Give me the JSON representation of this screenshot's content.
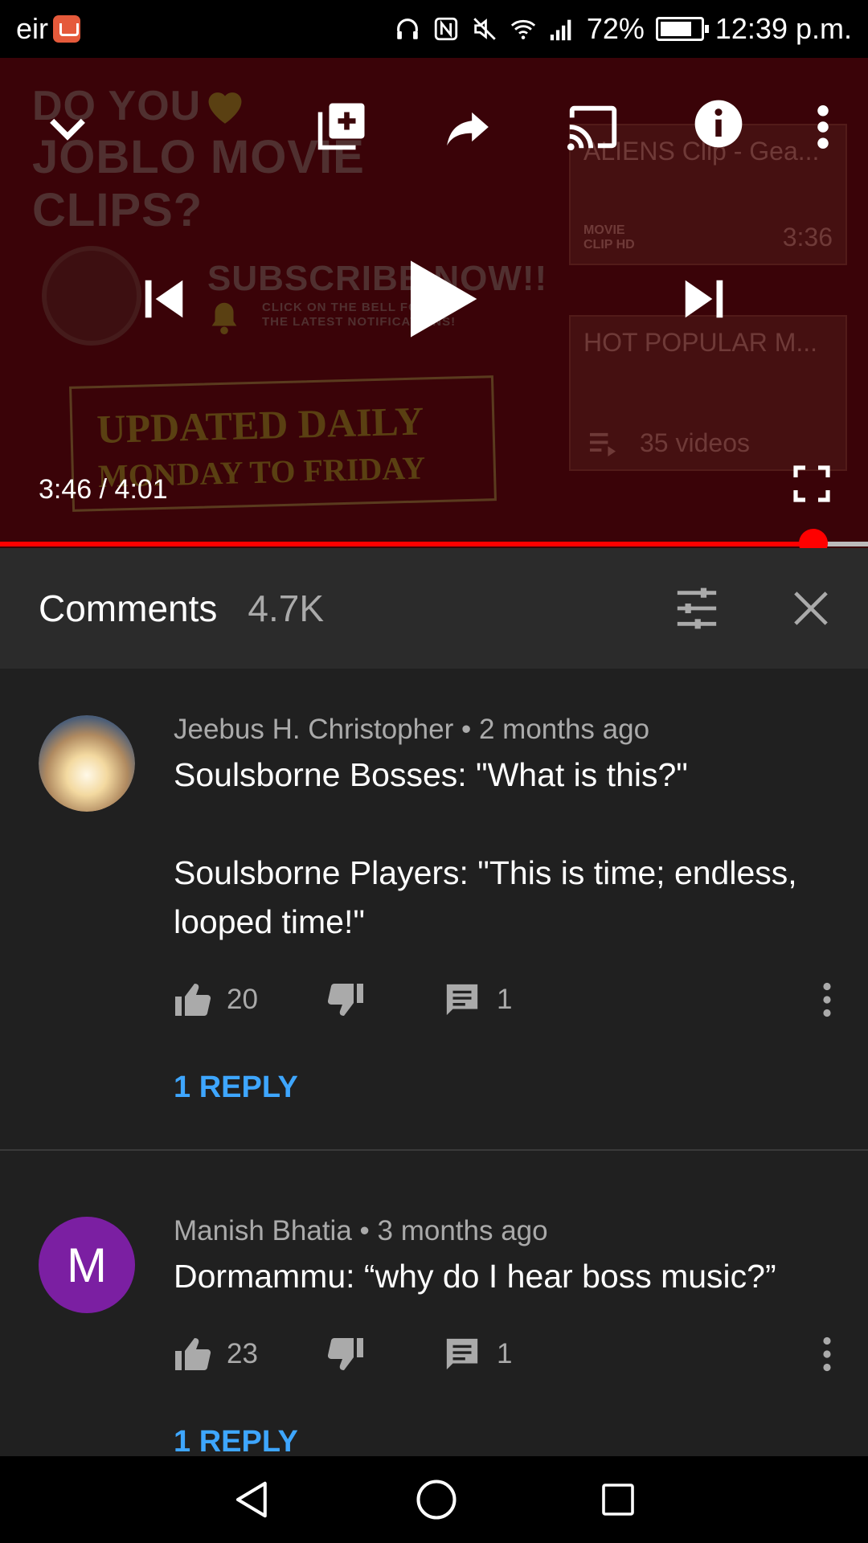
{
  "status_bar": {
    "carrier": "eir",
    "battery": "72%",
    "time": "12:39 p.m."
  },
  "player": {
    "background_text": {
      "line1": "DO YOU",
      "line2": "JOBLO MOVIE",
      "line3": "CLIPS?",
      "subscribe": "SUBSCRIBE NOW!!",
      "bell_line1": "CLICK ON THE BELL FOR",
      "bell_line2": "THE LATEST NOTIFICATIONS!",
      "updated1": "UPDATED DAILY",
      "updated2": "MONDAY TO FRIDAY"
    },
    "end_cards": [
      {
        "title": "ALIENS Clip - Gea...",
        "duration": "3:36",
        "badge": "MOVIE CLIP HD"
      },
      {
        "title": "HOT POPULAR M...",
        "duration": "35 videos"
      }
    ],
    "time_current": "3:46",
    "time_separator": "/",
    "time_total": "4:01",
    "progress": 0.937,
    "accent": "#ff0000"
  },
  "comments_header": {
    "title": "Comments",
    "count": "4.7K"
  },
  "comments": [
    {
      "author": "Jeebus H. Christopher",
      "separator": "•",
      "age": "2 months ago",
      "text": "Soulsborne Bosses: \"What is this?\"\n\nSoulsborne Players: \"This is time; endless, looped time!\"",
      "likes": "20",
      "replies_count": "1",
      "reply_link": "1 REPLY"
    },
    {
      "author": "Manish Bhatia",
      "separator": "•",
      "age": "3 months ago",
      "text": "Dormammu: “why do I hear boss music?”",
      "likes": "23",
      "replies_count": "1",
      "reply_link": "1 REPLY",
      "avatar_letter": "M",
      "avatar_color": "#7b1fa2"
    }
  ],
  "colors": {
    "link": "#3ea6ff",
    "panel": "#202020",
    "header": "#2b2b2b"
  }
}
